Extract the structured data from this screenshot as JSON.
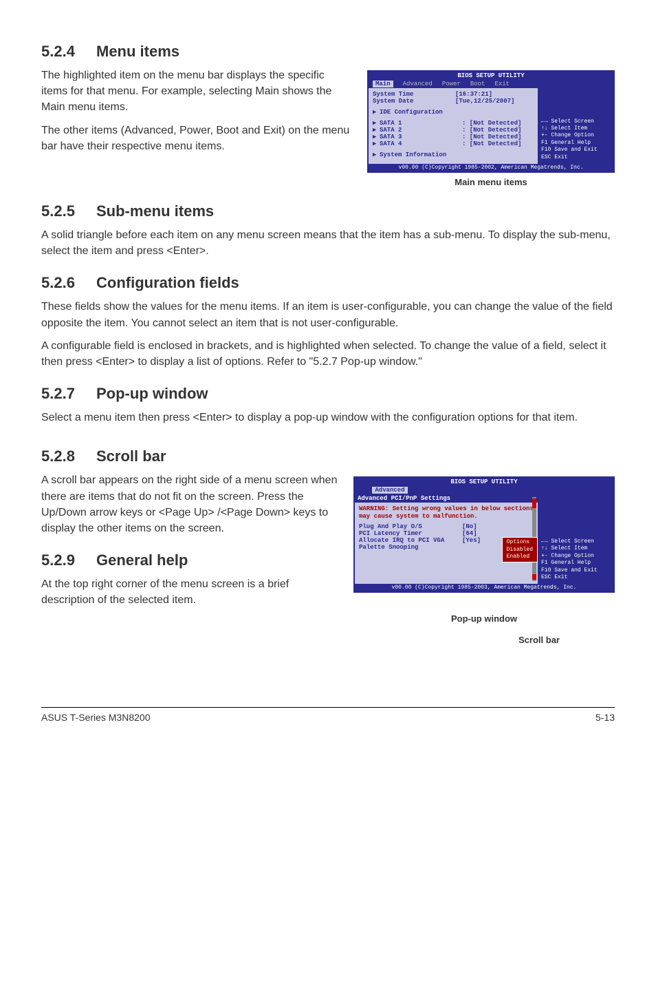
{
  "s524": {
    "heading_num": "5.2.4",
    "heading_txt": "Menu items",
    "p1": "The highlighted item on the menu bar  displays the specific items for that menu. For example, selecting Main shows the Main menu items.",
    "p2": "The other items (Advanced, Power, Boot and Exit) on the menu bar have their respective menu items."
  },
  "bios_main": {
    "title": "BIOS SETUP UTILITY",
    "tabs": [
      "Main",
      "Advanced",
      "Power",
      "Boot",
      "Exit"
    ],
    "lines": [
      {
        "label": "System Time",
        "val": "[16:37:21]"
      },
      {
        "label": "System Date",
        "val": "[Tue,12/25/2007]"
      }
    ],
    "ide": "IDE Configuration",
    "sata": [
      {
        "label": "SATA 1",
        "val": ": [Not Detected]"
      },
      {
        "label": "SATA 2",
        "val": ": [Not Detected]"
      },
      {
        "label": "SATA 3",
        "val": ": [Not Detected]"
      },
      {
        "label": "SATA 4",
        "val": ": [Not Detected]"
      }
    ],
    "sysinfo": "System Information",
    "legend": [
      "←→  Select Screen",
      "↑↓  Select Item",
      "+-  Change Option",
      "F1  General Help",
      "F10 Save and Exit",
      "ESC Exit"
    ],
    "copyright": "v00.00 (C)Copyright 1985-2002, American Megatrends, Inc.",
    "caption": "Main menu items"
  },
  "s525": {
    "heading_num": "5.2.5",
    "heading_txt": "Sub-menu items",
    "p1": "A solid triangle before each item on any menu screen means that the item has a sub-menu. To display the sub-menu, select the item and press <Enter>."
  },
  "s526": {
    "heading_num": "5.2.6",
    "heading_txt": "Configuration fields",
    "p1": "These fields show the values for the menu items. If an item is user-configurable, you can change the value of the field opposite the item. You cannot select an item that is not user-configurable.",
    "p2": "A configurable field is enclosed in brackets, and is highlighted when selected. To change the value of a field, select it then press <Enter> to display a list of options. Refer to \"5.2.7 Pop-up window.\""
  },
  "s527": {
    "heading_num": "5.2.7",
    "heading_txt": "Pop-up window",
    "p1": "Select a menu item then press <Enter> to display a pop-up window with the configuration options for that item."
  },
  "s528": {
    "heading_num": "5.2.8",
    "heading_txt": "Scroll bar",
    "p1": "A scroll bar appears on the right side of a menu screen when there are items that do not fit on the screen. Press the Up/Down arrow keys or <Page Up> /<Page Down> keys to display the other items on the screen."
  },
  "s529": {
    "heading_num": "5.2.9",
    "heading_txt": "General help",
    "p1": "At the top right corner of the menu screen is a brief description of the selected item."
  },
  "bios_adv": {
    "title": "BIOS SETUP UTILITY",
    "tab": "Advanced",
    "subhead": "Advanced PCI/PnP Settings",
    "warn": "WARNING: Setting wrong values in below sections may cause system to malfunction.",
    "rows": [
      {
        "label": "Plug And Play O/S",
        "val": "[No]"
      },
      {
        "label": "PCI Latency Timer",
        "val": "[64]"
      },
      {
        "label": "Allocate IRQ to PCI VGA",
        "val": "[Yes]"
      },
      {
        "label": "Palette Snooping",
        "val": ""
      }
    ],
    "popup_title": "Options",
    "popup_opts": [
      "Disabled",
      "Enabled"
    ],
    "legend": [
      "←→  Select Screen",
      "↑↓  Select Item",
      "+-  Change Option",
      "F1  General Help",
      "F10 Save and Exit",
      "ESC Exit"
    ],
    "copyright": "v00.00 (C)Copyright 1985-2003, American Megatrends, Inc.",
    "caption_popup": "Pop-up window",
    "caption_scroll": "Scroll bar"
  },
  "footer": {
    "left": "ASUS T-Series M3N8200",
    "right": "5-13"
  }
}
